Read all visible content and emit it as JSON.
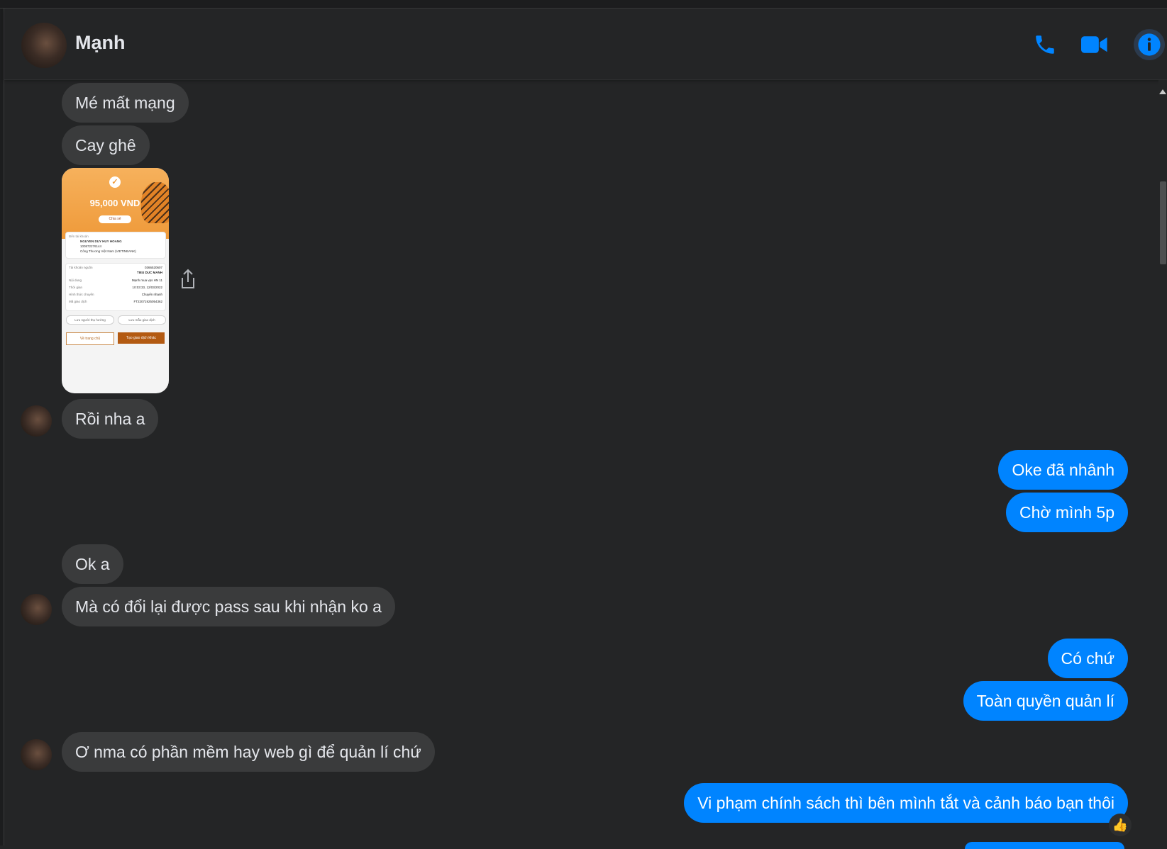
{
  "header": {
    "contact_name": "Mạnh",
    "icons": [
      "phone-icon",
      "video-camera-icon",
      "info-icon"
    ]
  },
  "colors": {
    "background": "#242526",
    "incoming_bubble": "#3a3b3c",
    "outgoing_bubble": "#0084ff",
    "accent": "#0084ff"
  },
  "messages": [
    {
      "side": "in",
      "text": "Mé mất mạng"
    },
    {
      "side": "in",
      "text": "Cay ghê"
    },
    {
      "side": "in",
      "type": "image",
      "text": "transfer-receipt-image"
    },
    {
      "side": "in",
      "text": "Rồi nha a"
    },
    {
      "side": "out",
      "text": "Oke đã nhânh"
    },
    {
      "side": "out",
      "text": "Chờ mình 5p"
    },
    {
      "side": "in",
      "text": "Ok a"
    },
    {
      "side": "in",
      "text": "Mà có đổi lại được pass sau khi nhận ko a"
    },
    {
      "side": "out",
      "text": "Có chứ"
    },
    {
      "side": "out",
      "text": "Toàn quyền quản lí"
    },
    {
      "side": "in",
      "text": "Ơ nma có phần mềm hay web gì để quản lí chứ"
    },
    {
      "side": "out",
      "text": "Vi phạm chính sách thì bên mình tắt và cảnh báo bạn thôi",
      "reaction": "👍"
    }
  ],
  "receipt": {
    "amount": "95,000 VND",
    "share": "Chia sẻ",
    "to_label": "Đến tài khoản",
    "recipient": "NGUYEN DUY HUY HOANG",
    "recipient_account": "100872276144",
    "recipient_bank": "Công Thương Việt Nam (VIETINBANK)",
    "source_label": "Tài khoản nguồn",
    "source_account": "0366520607",
    "source_name": "TIEU DUC MANH",
    "rows": [
      {
        "label": "Nội dung",
        "value": "Mạnh mua vps HN 11"
      },
      {
        "label": "Thời gian",
        "value": "10:03:33, 12/03/2022"
      },
      {
        "label": "Hình thức chuyển",
        "value": "Chuyển nhanh"
      },
      {
        "label": "Mã giao dịch",
        "value": "FT22071925054362"
      }
    ],
    "save_recipient": "Lưu người thụ hưởng",
    "save_template": "Lưu mẫu giao dịch",
    "home_button": "Về trang chủ",
    "new_tx_button": "Tạo giao dịch khác"
  }
}
